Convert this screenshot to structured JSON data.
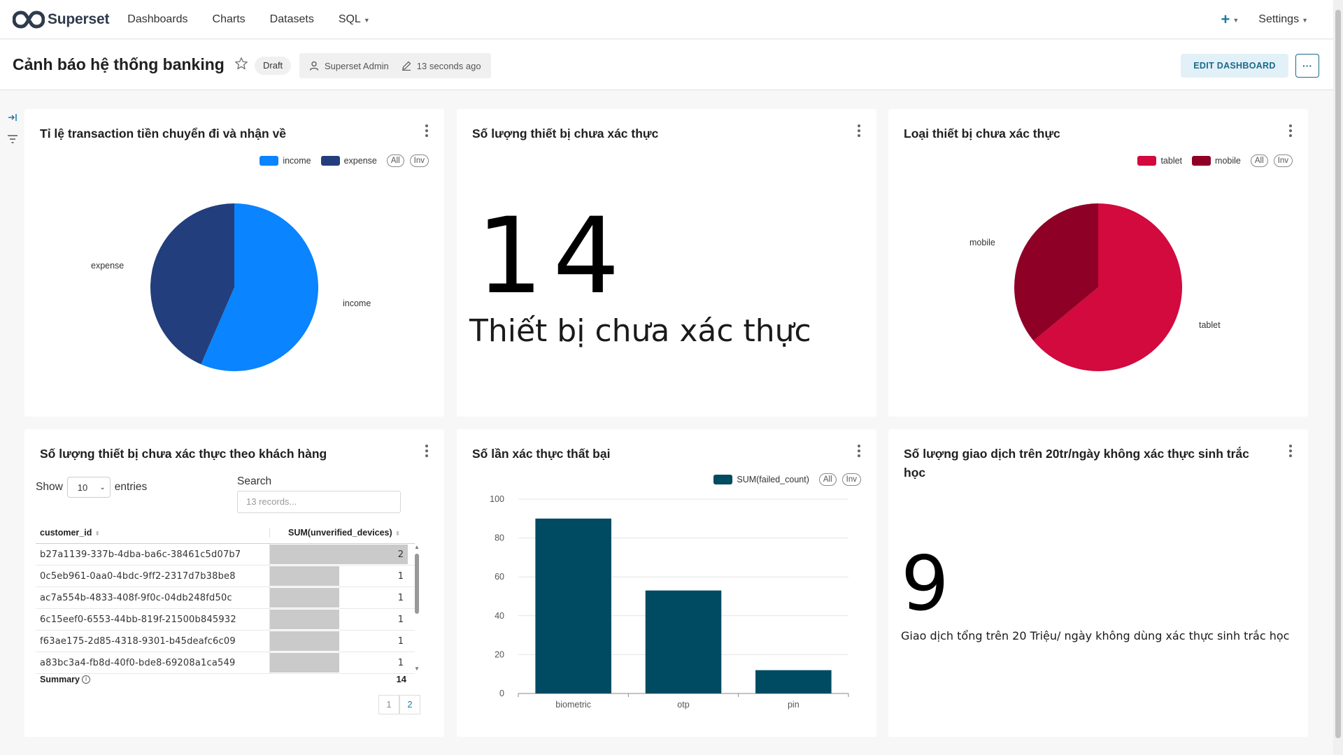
{
  "navbar": {
    "brand": "Superset",
    "menu": [
      "Dashboards",
      "Charts",
      "Datasets",
      "SQL"
    ],
    "plus": "+",
    "settings": "Settings"
  },
  "header": {
    "title": "Cảnh báo hệ thống banking",
    "status": "Draft",
    "owner": "Superset Admin",
    "modified": "13 seconds ago",
    "edit_label": "EDIT DASHBOARD",
    "more_label": "···"
  },
  "cards": {
    "c1": {
      "title": "Tỉ lệ transaction tiền chuyển đi và nhận về",
      "legend": [
        {
          "label": "income",
          "color": "#0a84ff"
        },
        {
          "label": "expense",
          "color": "#233e7c"
        }
      ],
      "pill_all": "All",
      "pill_inv": "Inv",
      "labels": {
        "expense": "expense",
        "income": "income"
      }
    },
    "c2": {
      "title": "Số lượng thiết bị chưa xác thực",
      "value": "14",
      "subtitle": "Thiết bị chưa xác thực"
    },
    "c3": {
      "title": "Loại thiết bị chưa xác thực",
      "legend": [
        {
          "label": "tablet",
          "color": "#d20a3e"
        },
        {
          "label": "mobile",
          "color": "#8f0026"
        }
      ],
      "pill_all": "All",
      "pill_inv": "Inv",
      "labels": {
        "mobile": "mobile",
        "tablet": "tablet"
      }
    },
    "c4": {
      "title": "Số lượng thiết bị chưa xác thực theo khách hàng",
      "show_label": "Show",
      "page_size": "10",
      "entries_label": "entries",
      "search_label": "Search",
      "search_placeholder": "13 records...",
      "columns": [
        "customer_id",
        "SUM(unverified_devices)"
      ],
      "rows": [
        {
          "id": "b27a1139-337b-4dba-ba6c-38461c5d07b7",
          "value": 2
        },
        {
          "id": "0c5eb961-0aa0-4bdc-9ff2-2317d7b38be8",
          "value": 1
        },
        {
          "id": "ac7a554b-4833-408f-9f0c-04db248fd50c",
          "value": 1
        },
        {
          "id": "6c15eef0-6553-44bb-819f-21500b845932",
          "value": 1
        },
        {
          "id": "f63ae175-2d85-4318-9301-b45deafc6c09",
          "value": 1
        },
        {
          "id": "a83bc3a4-fb8d-40f0-bde8-69208a1ca549",
          "value": 1
        }
      ],
      "summary_label": "Summary",
      "summary_value": "14",
      "pages": [
        "1",
        "2"
      ]
    },
    "c5": {
      "title": "Số lần xác thực thất bại",
      "legend_label": "SUM(failed_count)",
      "pill_all": "All",
      "pill_inv": "Inv"
    },
    "c6": {
      "title": "Số lượng giao dịch trên 20tr/ngày không xác thực sinh trắc học",
      "value": "9",
      "subtitle": "Giao dịch tổng trên 20 Triệu/ ngày không dùng xác thực sinh trắc học"
    }
  },
  "chart_data": [
    {
      "type": "pie",
      "labels": [
        "income",
        "expense"
      ],
      "values": [
        56.5,
        43.5
      ],
      "colors": [
        "#0a84ff",
        "#233e7c"
      ]
    },
    {
      "type": "pie",
      "labels": [
        "tablet",
        "mobile"
      ],
      "values": [
        64,
        36
      ],
      "colors": [
        "#d20a3e",
        "#8f0026"
      ]
    },
    {
      "type": "bar",
      "categories": [
        "biometric",
        "otp",
        "pin"
      ],
      "series": [
        {
          "name": "SUM(failed_count)",
          "values": [
            90,
            53,
            12
          ]
        }
      ],
      "ylim": [
        0,
        100
      ],
      "yticks": [
        0,
        20,
        40,
        60,
        80,
        100
      ],
      "color": "#004a62",
      "grid": true
    }
  ]
}
